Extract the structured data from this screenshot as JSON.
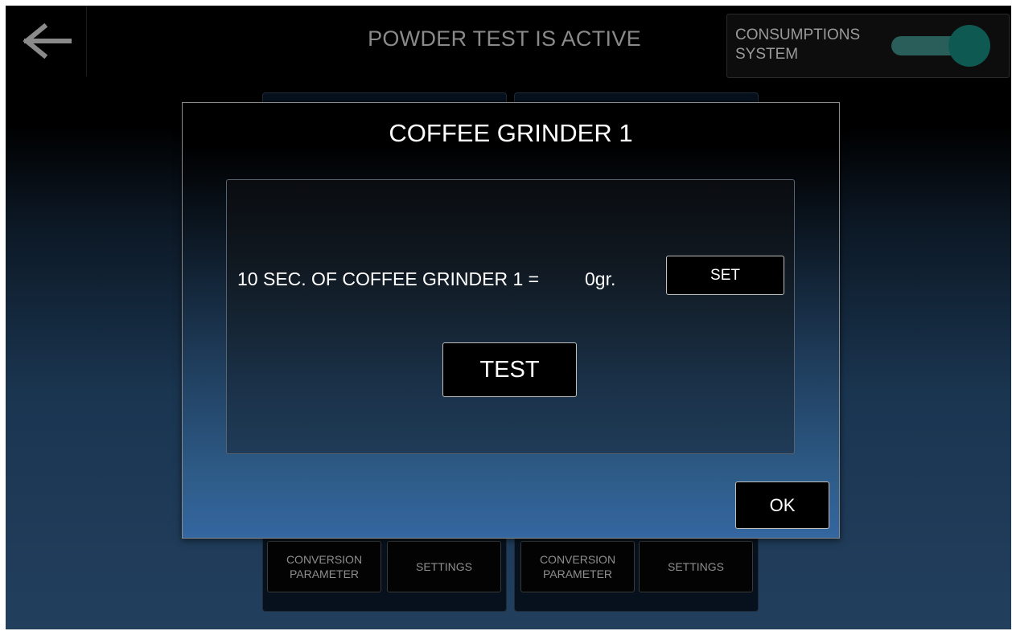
{
  "header": {
    "title": "POWDER TEST IS ACTIVE",
    "back_icon": "arrow-left-icon",
    "consumption_label": "CONSUMPTIONS SYSTEM",
    "consumption_toggle": "on"
  },
  "background_panels": [
    {
      "conversion_label": "CONVERSION\nPARAMETER",
      "settings_label": "SETTINGS"
    },
    {
      "conversion_label": "CONVERSION\nPARAMETER",
      "settings_label": "SETTINGS"
    }
  ],
  "dialog": {
    "title": "COFFEE GRINDER 1",
    "measurement_label": "10 SEC. OF COFFEE GRINDER 1 =",
    "measurement_value": "0gr.",
    "set_label": "SET",
    "test_label": "TEST",
    "ok_label": "OK"
  },
  "colors": {
    "accent_toggle": "#0e5a52",
    "dialog_bottom": "#3466a0"
  }
}
